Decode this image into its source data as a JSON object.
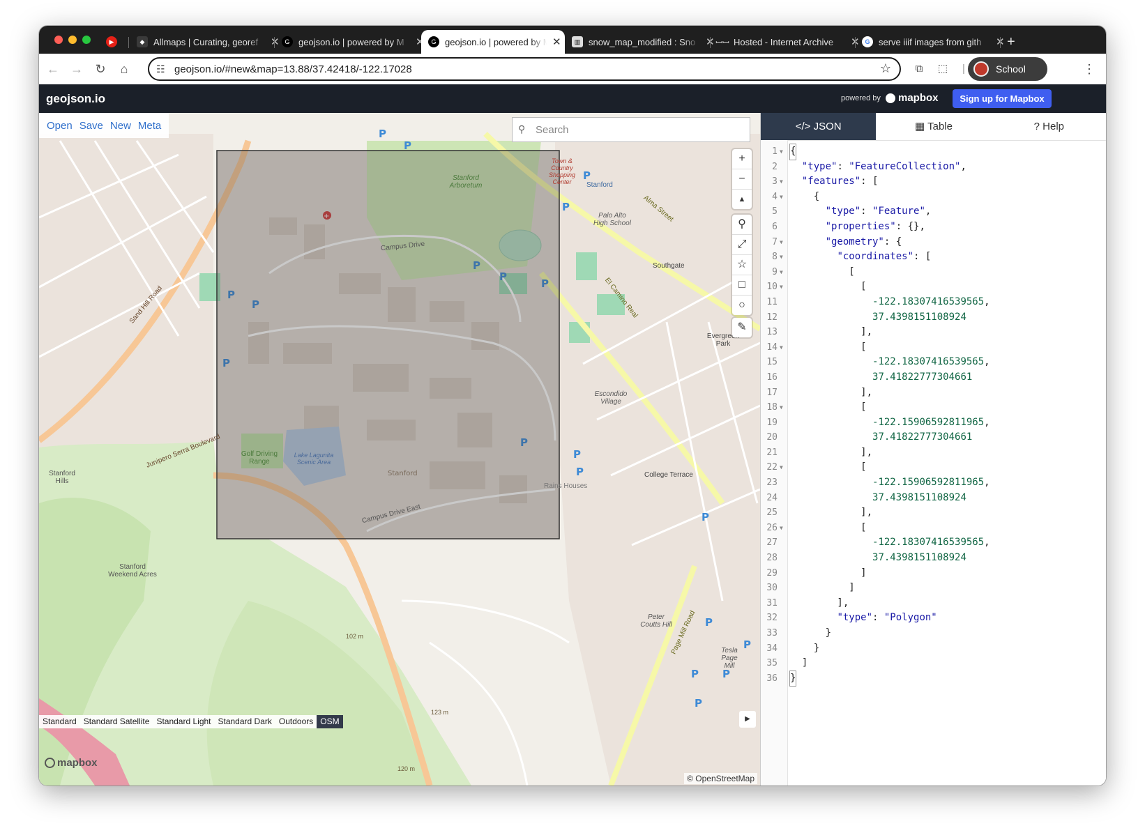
{
  "browser": {
    "tabs": [
      {
        "title": "Allmaps | Curating, georef",
        "active": false
      },
      {
        "title": "geojson.io | powered by M",
        "active": false
      },
      {
        "title": "geojson.io | powered by M",
        "active": true
      },
      {
        "title": "snow_map_modified : Sno",
        "active": false
      },
      {
        "title": "Hosted - Internet Archive",
        "active": false
      },
      {
        "title": "serve iiif images from gith",
        "active": false
      }
    ],
    "new_tab": "+",
    "url": "geojson.io/#new&map=13.88/37.42418/-122.17028",
    "profile_label": "School"
  },
  "app": {
    "brand": "geojson.io",
    "powered_by": "powered by",
    "mapbox_label": "mapbox",
    "signup_label": "Sign up for Mapbox"
  },
  "map": {
    "menu": [
      "Open",
      "Save",
      "New",
      "Meta"
    ],
    "search_placeholder": "Search",
    "zoom_in": "+",
    "zoom_out": "−",
    "compass": "▲",
    "styles": [
      {
        "label": "Standard",
        "selected": false
      },
      {
        "label": "Standard Satellite",
        "selected": false
      },
      {
        "label": "Standard Light",
        "selected": false
      },
      {
        "label": "Standard Dark",
        "selected": false
      },
      {
        "label": "Outdoors",
        "selected": false
      },
      {
        "label": "OSM",
        "selected": true
      }
    ],
    "watermark": "mapbox",
    "attribution": "© OpenStreetMap",
    "labels": {
      "stanford": "Stanford",
      "arboretum": "Stanford Arboretum",
      "palo_alto_hs": "Palo Alto High School",
      "southgate": "Southgate",
      "evergreen_park": "Evergreen Park",
      "escondido_village": "Escondido Village",
      "college_terrace": "College Terrace",
      "golf_range": "Golf Driving Range",
      "lake_lagunita": "Lake Lagunita Scenic Area",
      "stanford_hills": "Stanford Hills",
      "weekend_acres": "Stanford Weekend Acres",
      "junipero": "Junipero Serra Boulevard",
      "sand_hill": "Sand Hill Road",
      "el_camino": "El Camino Real",
      "alma": "Alma Street",
      "page_mill": "Page Mill Road",
      "campus_drive": "Campus Drive",
      "campus_drive_east": "Campus Drive East",
      "peter_coutts": "Peter Coutts Hill",
      "tesla": "Tesla Page Mill",
      "rains": "Rains Houses",
      "elev_102": "102 m",
      "elev_123": "123 m",
      "elev_120": "120 m",
      "town_country": "Town & Country Shopping Center"
    }
  },
  "panel": {
    "tabs": [
      {
        "label": "JSON",
        "icon": "code-icon",
        "active": true
      },
      {
        "label": "Table",
        "icon": "table-icon",
        "active": false
      },
      {
        "label": "Help",
        "icon": "help-icon",
        "active": false
      }
    ],
    "lines": [
      "{",
      "  \"type\": \"FeatureCollection\",",
      "  \"features\": [",
      "    {",
      "      \"type\": \"Feature\",",
      "      \"properties\": {},",
      "      \"geometry\": {",
      "        \"coordinates\": [",
      "          [",
      "            [",
      "              -122.18307416539565,",
      "              37.4398151108924",
      "            ],",
      "            [",
      "              -122.18307416539565,",
      "              37.41822777304661",
      "            ],",
      "            [",
      "              -122.15906592811965,",
      "              37.41822777304661",
      "            ],",
      "            [",
      "              -122.15906592811965,",
      "              37.4398151108924",
      "            ],",
      "            [",
      "              -122.18307416539565,",
      "              37.4398151108924",
      "            ]",
      "          ]",
      "        ],",
      "        \"type\": \"Polygon\"",
      "      }",
      "    }",
      "  ]",
      "}"
    ],
    "foldable": [
      1,
      3,
      4,
      7,
      8,
      9,
      10,
      14,
      18,
      22,
      26
    ]
  }
}
